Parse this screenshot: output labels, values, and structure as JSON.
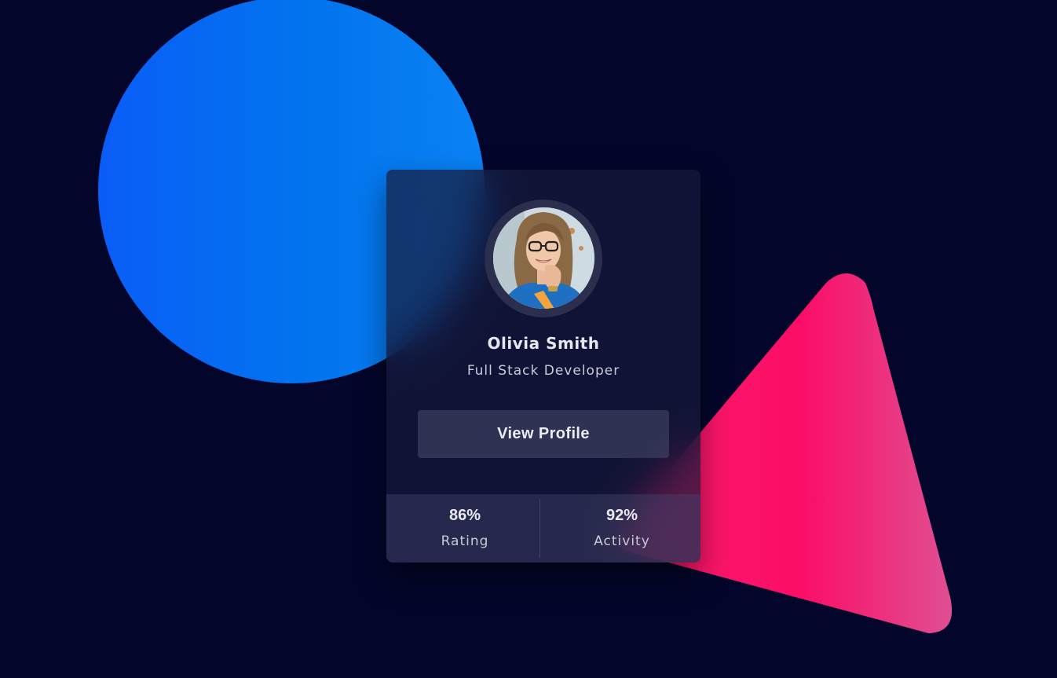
{
  "colors": {
    "background": "#03062a",
    "circle": "#0274ee",
    "triangle": "#fb0d66",
    "card": "#1a1d3e"
  },
  "profile": {
    "avatar_alt": "avatar-photo",
    "name": "Olivia Smith",
    "role": "Full Stack Developer",
    "button_label": "View Profile"
  },
  "stats": [
    {
      "value": "86%",
      "label": "Rating"
    },
    {
      "value": "92%",
      "label": "Activity"
    }
  ]
}
